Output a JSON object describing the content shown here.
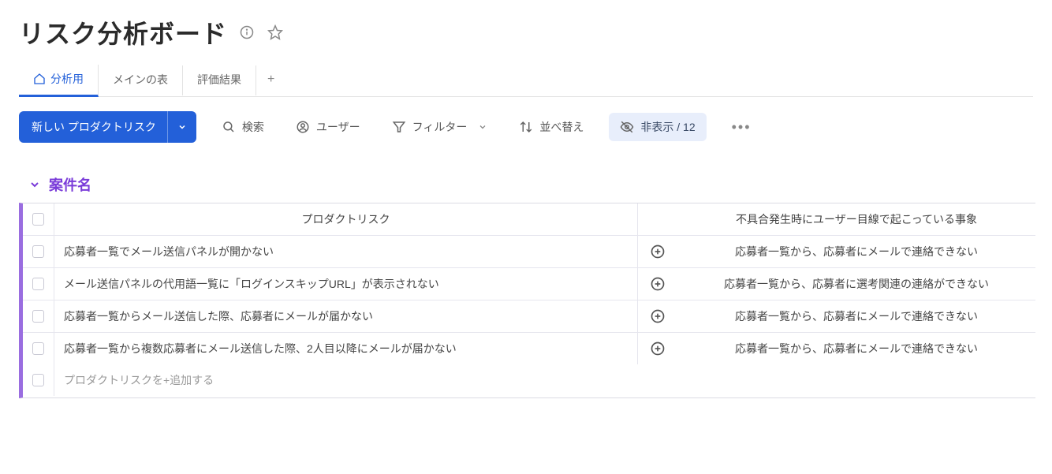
{
  "header": {
    "title": "リスク分析ボード"
  },
  "tabs": {
    "items": [
      {
        "label": "分析用"
      },
      {
        "label": "メインの表"
      },
      {
        "label": "評価結果"
      }
    ]
  },
  "toolbar": {
    "new_label": "新しい プロダクトリスク",
    "search_label": "検索",
    "user_label": "ユーザー",
    "filter_label": "フィルター",
    "sort_label": "並べ替え",
    "hidden_label": "非表示 / 12"
  },
  "group": {
    "title": "案件名"
  },
  "table": {
    "col_risk": "プロダクトリスク",
    "col_phen": "不具合発生時にユーザー目線で起こっている事象",
    "add_row": "プロダクトリスクを+追加する",
    "rows": [
      {
        "risk": "応募者一覧でメール送信パネルが開かない",
        "phen": "応募者一覧から、応募者にメールで連絡できない"
      },
      {
        "risk": "メール送信パネルの代用語一覧に「ログインスキップURL」が表示されない",
        "phen": "応募者一覧から、応募者に選考関連の連絡ができない"
      },
      {
        "risk": "応募者一覧からメール送信した際、応募者にメールが届かない",
        "phen": "応募者一覧から、応募者にメールで連絡できない"
      },
      {
        "risk": "応募者一覧から複数応募者にメール送信した際、2人目以降にメールが届かない",
        "phen": "応募者一覧から、応募者にメールで連絡できない"
      }
    ]
  }
}
